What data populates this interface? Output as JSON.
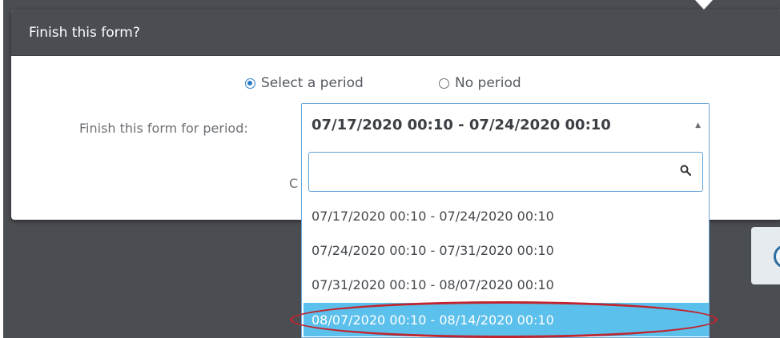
{
  "modal": {
    "title": "Finish this form?",
    "radio_select_period": "Select a period",
    "radio_no_period": "No period",
    "period_label": "Finish this form for period:",
    "partial_text": "C"
  },
  "select": {
    "value": "07/17/2020 00:10 - 07/24/2020 00:10",
    "search_placeholder": "",
    "options": [
      "07/17/2020 00:10 - 07/24/2020 00:10",
      "07/24/2020 00:10 - 07/31/2020 00:10",
      "07/31/2020 00:10 - 08/07/2020 00:10",
      "08/07/2020 00:10 - 08/14/2020 00:10"
    ],
    "highlighted_index": 3
  },
  "icons": {
    "caret": "caret-up-icon",
    "search": "search-icon",
    "radio": "radio-icon"
  },
  "colors": {
    "header_bg": "#4a4d51",
    "highlight": "#5bc0eb",
    "radio_accent": "#2a7ac7",
    "annotation": "#c0252f"
  }
}
